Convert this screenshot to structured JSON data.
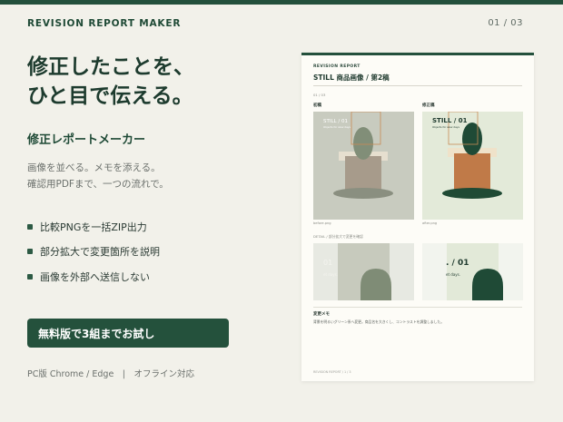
{
  "header": {
    "brand": "REVISION REPORT MAKER",
    "pager": "01 / 03"
  },
  "hero": {
    "headline_line1": "修正したことを、",
    "headline_line2": "ひと目で伝える。",
    "subtitle": "修正レポートメーカー",
    "desc_line1": "画像を並べる。メモを添える。",
    "desc_line2": "確認用PDFまで、一つの流れで。"
  },
  "features": [
    "比較PNGを一括ZIP出力",
    "部分拡大で変更箇所を説明",
    "画像を外部へ送信しない"
  ],
  "cta": {
    "label": "無料版で3組までお試し"
  },
  "footer_note": "PC版 Chrome / Edge　|　オフライン対応",
  "report": {
    "kicker": "REVISION REPORT",
    "title": "STILL 商品画像 / 第2稿",
    "page": "01 / 03",
    "before_label": "初稿",
    "after_label": "修正稿",
    "before_file": "before.png",
    "after_file": "after.png",
    "before_still": "STILL / 01",
    "after_still": "STILL / 01",
    "before_tagline": "Objects for slow days",
    "after_tagline": "Objects for slow days",
    "detail_label": "DETAIL / 部分拡大で変更を確認",
    "crop_before_big": "01",
    "crop_before_small": "et days.",
    "crop_after_big": ". / 01",
    "crop_after_small": "et days.",
    "memo_heading": "変更メモ",
    "memo_text": "背景を明るいグリーン系へ変更。商品名を大きくし、コントラストを調整しました。",
    "footer": "REVISION REPORT / 1 / 3"
  },
  "colors": {
    "brand_green": "#24503c",
    "background": "#f2f1ea"
  }
}
